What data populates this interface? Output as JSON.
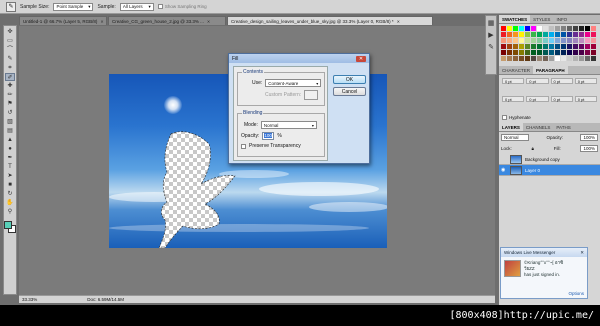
{
  "options_bar": {
    "sample_size_label": "Sample Size:",
    "sample_size_value": "Point Sample",
    "sample_label": "Sample:",
    "sample_value": "All Layers",
    "show_ring_label": "Show Sampling Ring"
  },
  "tabs": [
    {
      "label": "Untitled-1 @ 66.7% (Layer 5, RGB/8)"
    },
    {
      "label": "Creative_CG_green_house_2.jpg @ 33.3% ..."
    },
    {
      "label": "Creative_design_sailing_leaves_under_blue_sky.jpg @ 33.3% (Layer 0, RGB/8) *"
    }
  ],
  "status": {
    "zoom": "33.33%",
    "doc": "Doc: 6.59M/14.5M"
  },
  "fill_dialog": {
    "title": "Fill",
    "contents_label": "Contents",
    "use_label": "Use:",
    "use_value": "Content-Aware",
    "custom_pattern_label": "Custom Pattern:",
    "blending_label": "Blending",
    "mode_label": "Mode:",
    "mode_value": "Normal",
    "opacity_label": "Opacity:",
    "opacity_value": "100",
    "opacity_unit": "%",
    "preserve_label": "Preserve Transparency",
    "ok_label": "OK",
    "cancel_label": "Cancel"
  },
  "panels": {
    "swatches_tabs": [
      "SWATCHES",
      "STYLES",
      "INFO"
    ],
    "char_tabs": [
      "CHARACTER",
      "PARAGRAPH"
    ],
    "char_fields": [
      "0 pt",
      "0 pt",
      "0 pt",
      "0 pt",
      "0 pt",
      "0 pt",
      "0 pt",
      "0 pt"
    ],
    "hyphenate_label": "Hyphenate",
    "layers_tabs": [
      "LAYERS",
      "CHANNELS",
      "PATHS"
    ],
    "blend_mode": "Normal",
    "opacity_label": "Opacity:",
    "opacity_value": "100%",
    "lock_label": "Lock:",
    "fill_label": "Fill:",
    "fill_value": "100%",
    "layers": [
      {
        "name": "Background copy",
        "active": false
      },
      {
        "name": "Layer 0",
        "active": true
      }
    ]
  },
  "messenger": {
    "header": "Windows Live Messenger",
    "line1": "©Kriang°°x°°~[ อาซิ",
    "line2": "วียZZ",
    "line3": "has just signed in.",
    "options": "Options"
  },
  "watermark": "[800x408]http://upic.me/",
  "colors": {
    "foreground_swatch": "#58d0b8",
    "layer_highlight": "#3a88e0",
    "dialog_bg": "#cfe0f3"
  },
  "swatch_palette": [
    "#ff0000",
    "#ffff00",
    "#00ff00",
    "#00ffff",
    "#0000ff",
    "#ff00ff",
    "#ffffff",
    "#e0e0e0",
    "#c0c0c0",
    "#a0a0a0",
    "#808080",
    "#606060",
    "#404040",
    "#202020",
    "#000000",
    "#ff8080",
    "#ee1c24",
    "#f26522",
    "#f7941d",
    "#fff200",
    "#8dc63f",
    "#39b54a",
    "#00a651",
    "#00a99d",
    "#00aeef",
    "#0072bc",
    "#0054a6",
    "#2e3192",
    "#662d91",
    "#92278f",
    "#ec008c",
    "#ed145b",
    "#f69679",
    "#f9ad81",
    "#fdc68a",
    "#fff79a",
    "#c4df9b",
    "#a3d39c",
    "#82ca9c",
    "#7accc8",
    "#6dcff6",
    "#7da7d9",
    "#8393ca",
    "#8781bd",
    "#a186be",
    "#bd8cbf",
    "#f49ac1",
    "#f5989d",
    "#9e0b0f",
    "#a0410d",
    "#a36209",
    "#aba000",
    "#598527",
    "#1a7b30",
    "#007236",
    "#00746b",
    "#0076a3",
    "#004b80",
    "#003471",
    "#1b1464",
    "#440e62",
    "#630460",
    "#9e005d",
    "#9e0039",
    "#790000",
    "#7b2e00",
    "#7d4900",
    "#827b00",
    "#406618",
    "#005e20",
    "#005826",
    "#005952",
    "#005b7f",
    "#003663",
    "#002157",
    "#0d004c",
    "#32004b",
    "#4b0049",
    "#7b0046",
    "#7a0026",
    "#c69c6d",
    "#a67c52",
    "#8c6239",
    "#754c24",
    "#603913",
    "#534741",
    "#998675",
    "#736357",
    "#a0a0a0",
    "#ffffff",
    "#e6e6e6",
    "#cccccc",
    "#b3b3b3",
    "#999999",
    "#666666",
    "#333333"
  ]
}
